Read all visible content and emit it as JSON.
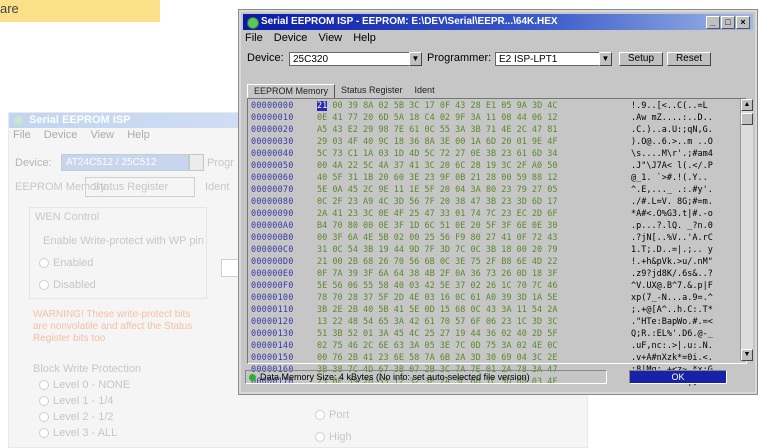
{
  "header_fragment": "are",
  "background_window": {
    "title": "Serial EEPROM ISP",
    "menu": [
      "File",
      "Device",
      "View",
      "Help"
    ],
    "device_label": "Device:",
    "device_value": "AT24C512 / 25C512",
    "programmer_label": "Progr",
    "tabs": [
      "EEPROM Memory",
      "Status Register",
      "Ident"
    ],
    "group_title": "WEN Control",
    "group_text": "Enable Write-protect with WP pin",
    "radio_enabled": "Enabled",
    "radio_disabled": "Disabled",
    "warning_text": "WARNING! These write-protect bits are nonvolatile and affect the Status Register bits too",
    "block_title": "Block Write Protection",
    "levels": [
      "Level 0 - NONE",
      "Level 1 - 1/4",
      "Level 2 - 1/2",
      "Level 3 - ALL"
    ],
    "right_options": [
      "Port",
      "High"
    ]
  },
  "window": {
    "title": "Serial EEPROM ISP - EEPROM: E:\\DEV\\Serial\\EEPR...\\64K.HEX",
    "menu": [
      "File",
      "Device",
      "View",
      "Help"
    ],
    "device_label": "Device:",
    "device_value": "25C320",
    "programmer_label": "Programmer:",
    "programmer_value": "E2 ISP-LPT1",
    "setup_button": "Setup",
    "reset_button": "Reset",
    "tabs": [
      "EEPROM Memory",
      "Status Register",
      "Ident"
    ],
    "active_tab_index": 0,
    "addresses": [
      "00000000",
      "00000010",
      "00000020",
      "00000030",
      "00000040",
      "00000050",
      "00000060",
      "00000070",
      "00000080",
      "00000090",
      "000000A0",
      "000000B0",
      "000000C0",
      "000000D0",
      "000000E0",
      "000000F0",
      "00000100",
      "00000110",
      "00000120",
      "00000130",
      "00000140",
      "00000150",
      "00000160",
      "00000170"
    ],
    "hex_rows": [
      "21 00 39 8A 02 5B 3C 17 0F 43 28 E1 05 9A 3D 4C",
      "0E 41 77 20 6D 5A 18 C4 02 9F 3A 11 08 44 06 12",
      "A5 43 E2 29 98 7E 61 0C 55 3A 3B 71 4E 2C 47 81",
      "29 03 4F 40 9C 18 36 8A 3E 00 1A 6D 20 01 9E 4F",
      "5C 73 C1 1A 03 1D 4D 5C 72 27 0E 3B 23 61 6D 34",
      "00 4A 22 5C 4A 37 41 3C 20 6C 28 19 3C 2F A0 50",
      "40 5F 31 1B 20 60 3E 23 9F 0B 21 28 00 59 88 12",
      "5E 0A 45 2C 9E 11 1E 5F 20 04 3A 80 23 79 27 05",
      "0C 2F 23 A9 4C 3D 56 7F 20 38 47 3B 23 3D 6D 17",
      "2A 41 23 3C 0E 4F 25 47 33 01 74 7C 23 EC 2D 6F",
      "B4 70 80 00 0E 3F 1D 6C 51 0E 20 5F 3F 6E 0E 30",
      "00 3F 6A 4E 5B 02 00 25 56 F9 80 27 41 0F 72 43",
      "31 0C 54 3B 19 44 9D 7F 3D 7C 0C 3B 18 00 20 79",
      "21 00 2B 68 26 70 56 6B 0C 3E 75 2F B8 6E 4D 22",
      "0F 7A 39 3F 6A 64 38 4B 2F 0A 36 73 26 0D 18 3F",
      "5E 56 06 55 58 40 03 42 5E 37 02 26 1C 70 7C 46",
      "78 70 28 37 5F 2D 4E 03 16 0C 61 A0 39 3D 1A 5E",
      "3B 2E 2B 40 5B 41 5E 0D 15 68 0C 43 3A 11 54 2A",
      "13 22 48 54 65 3A 42 61 70 57 6F 06 23 1C 3D 3C",
      "51 3B 52 01 3A 45 4C 25 27 19 44 36 02 40 2D 5F",
      "02 75 46 2C 6E 63 3A 05 3E 7C 0D 75 3A 02 4E 0C",
      "00 76 2B 41 23 6E 58 7A 6B 2A 3D 30 69 04 3C 2E",
      "3B 38 7C 4D 67 3B 07 2B 3C 7A 7E 01 2A 78 3A 47",
      "23 0E 39 26 53 12 32 3E 2A 3C 6B 7C 5D 08 03 4F"
    ],
    "ascii_rows": [
      "!.9..[<..C(..=L ",
      ".Aw mZ....:..D..",
      ".C.)..a.U:;qN,G.",
      ").O@..6.>..m ..O",
      "\\s....M\\r'.;#am4",
      ".J\"\\J7A< l(.</.P",
      "@_1. `>#.!(.Y..",
      "^.E,..._ .:.#y'.",
      "./#.L=V. 8G;#=m.",
      "*A#<.O%G3.t|#.-o",
      ".p...?.lQ. _?n.0",
      ".?jN[..%V..'A.rC",
      "1.T;.D..=|.;.. y",
      "!.+h&pVk.>u/.nM\"",
      ".z9?jd8K/.6s&..?",
      "^V.UX@.B^7.&.p|F",
      "xp(7_-N...a.9=.^",
      ";.+@[A^..h.C:.T*",
      ".\"HTe:BapWo.#.=<",
      "Q;R.:EL%'.D6.@-_",
      ".uF,nc:.>|.u:.N.",
      ".v+A#nXzk*=0i.<.",
      ";8|Mg;.+<z~.*x:G",
      "#.9&S.2>*<k|]..O"
    ],
    "status_text": "Data Memory Size: 4 kBytes (No info: set auto-selected file version)",
    "progress_value": 1.0,
    "progress_label": "OK"
  }
}
